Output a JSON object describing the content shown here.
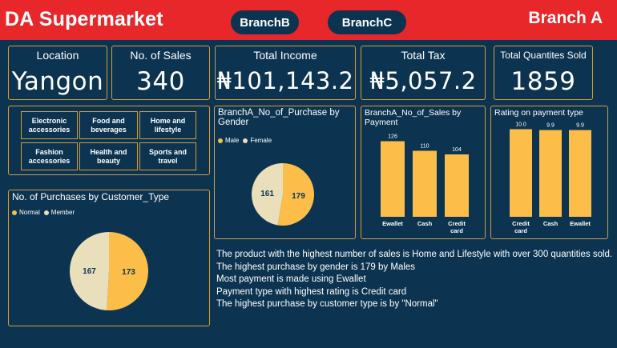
{
  "header": {
    "title": "DA Supermarket",
    "nav": [
      "BranchB",
      "BranchC"
    ],
    "branch": "Branch A"
  },
  "kpis": [
    {
      "label": "Location",
      "value": "Yangon"
    },
    {
      "label": "No. of Sales",
      "value": "340"
    },
    {
      "label": "Total Income",
      "value": "₦101,143.2"
    },
    {
      "label": "Total Tax",
      "value": "₦5,057.2"
    },
    {
      "label": "Total Quantites Sold",
      "value": "1859"
    }
  ],
  "product_lines": [
    "Electronic accessories",
    "Food and beverages",
    "Home and lifestyle",
    "Fashion accessories",
    "Health and beauty",
    "Sports and travel"
  ],
  "colors": {
    "background": "#0c3450",
    "header": "#e8272a",
    "border": "#d79c3a",
    "series_primary": "#fdbd49",
    "series_secondary": "#e9dfbb"
  },
  "chart_data": [
    {
      "type": "pie",
      "title": "BranchA_No_of_Purchase by Gender",
      "legend": [
        "Male",
        "Female"
      ],
      "values": [
        179,
        161
      ],
      "labels": [
        "179",
        "161"
      ]
    },
    {
      "type": "bar",
      "title": "BranchA_No_of_Sales by Payment",
      "categories": [
        "Ewallet",
        "Cash",
        "Credit card"
      ],
      "values": [
        126,
        110,
        104
      ],
      "labels": [
        "126",
        "110",
        "104"
      ],
      "ylim": [
        0,
        140
      ]
    },
    {
      "type": "bar",
      "title": "Rating on payment type",
      "categories": [
        "Credit card",
        "Cash",
        "Ewallet"
      ],
      "values": [
        10.0,
        9.9,
        9.9
      ],
      "labels": [
        "10.0",
        "9.9",
        "9.9"
      ],
      "ylim": [
        0,
        10.5
      ]
    },
    {
      "type": "pie",
      "title": "No. of Purchases by Customer_Type",
      "legend": [
        "Normal",
        "Member"
      ],
      "values": [
        173,
        167
      ],
      "labels": [
        "173",
        "167"
      ]
    }
  ],
  "insights": [
    "The product with the highest number of sales is Home and Lifestyle with over 300 quantities sold.",
    "The highest purchase by gender is 179 by Males",
    "Most payment is made using Ewallet",
    "Payment type with highest rating is Credit card",
    "The highest purchase by customer type is by \"Normal\""
  ]
}
